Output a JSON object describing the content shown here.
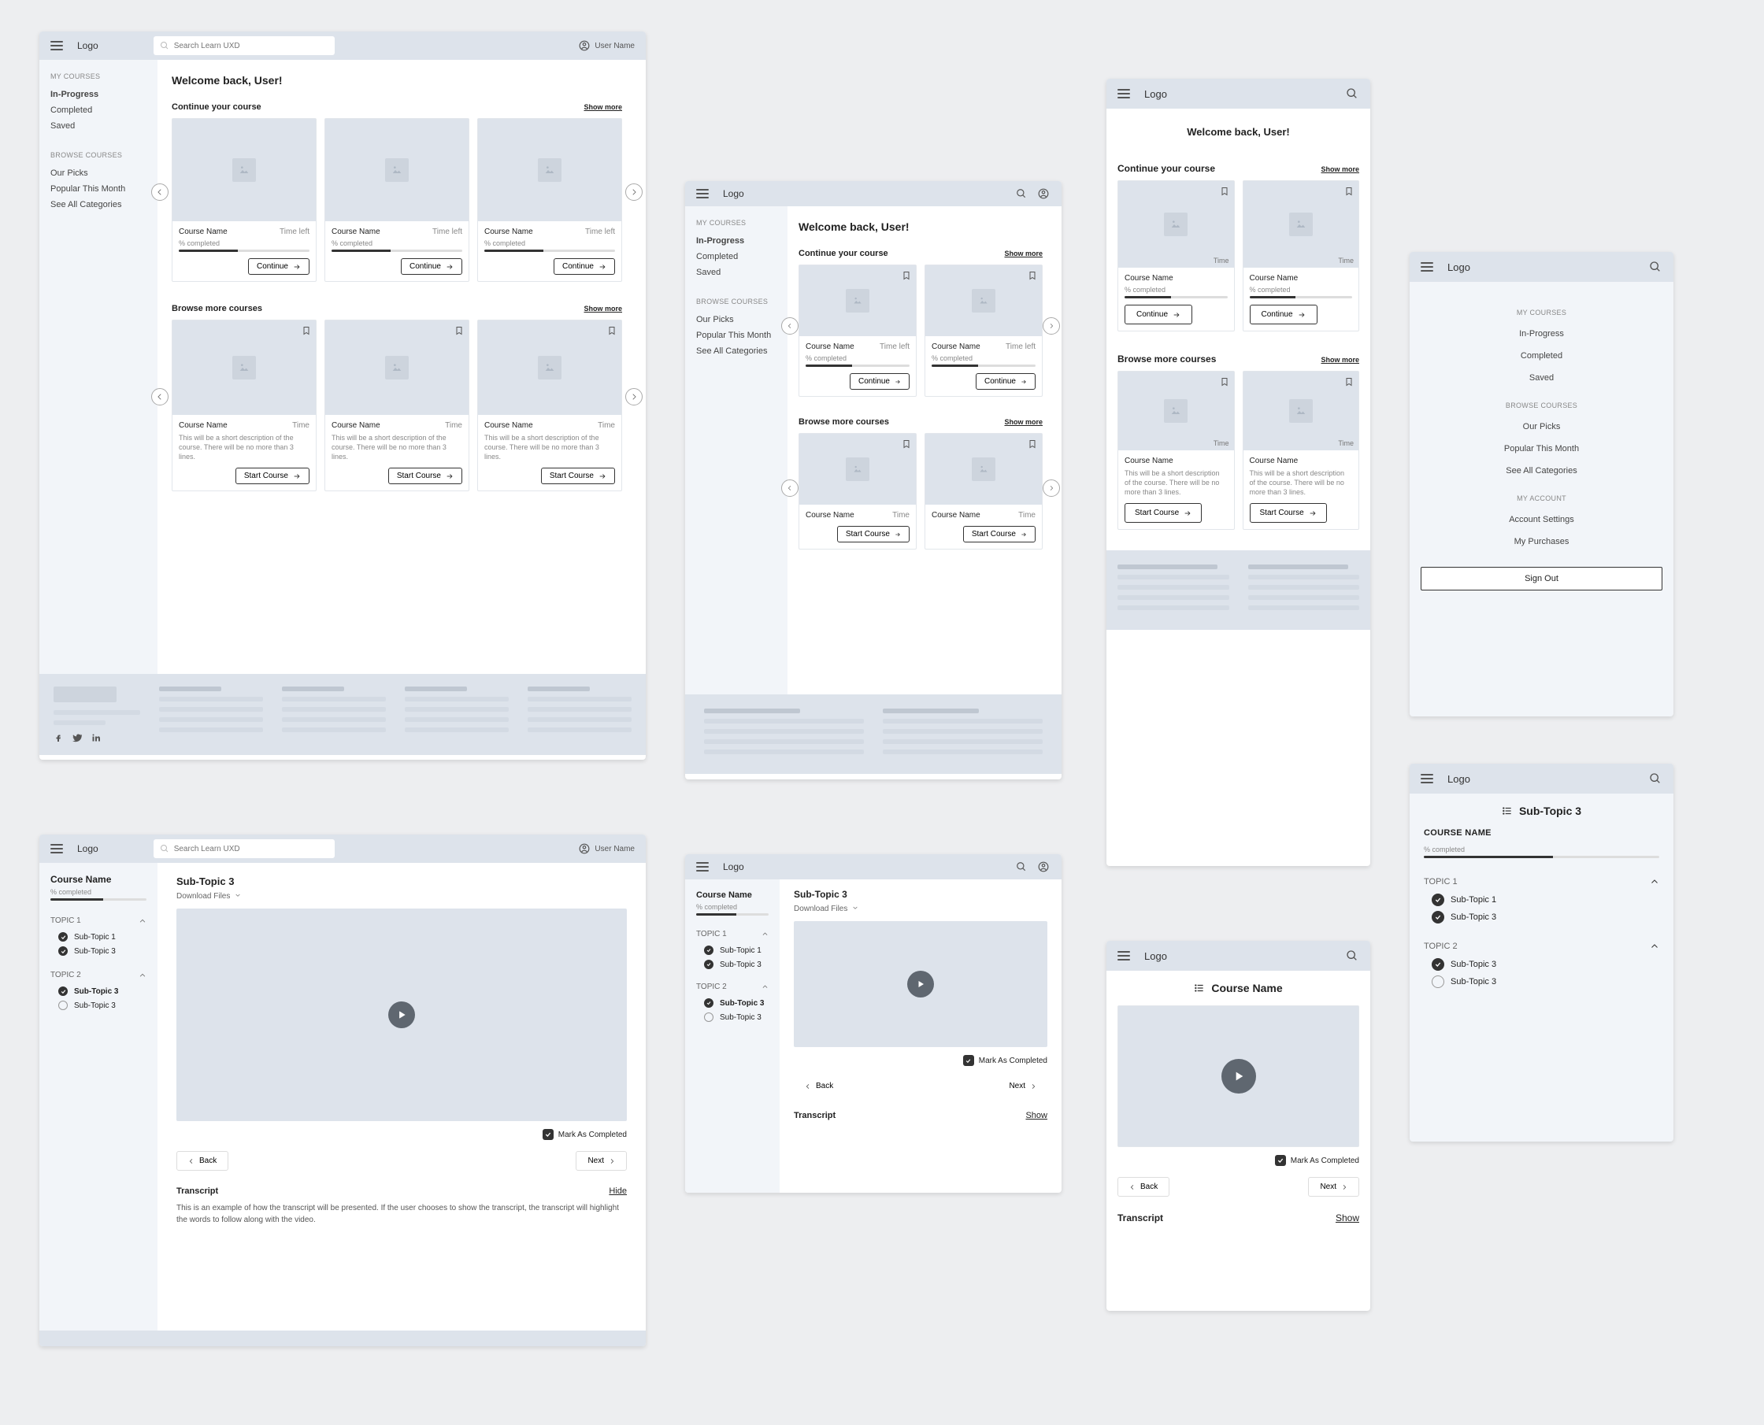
{
  "logo": "Logo",
  "user_name": "User Name",
  "search_placeholder": "Search Learn UXD",
  "welcome": "Welcome back, User!",
  "continue_title": "Continue your course",
  "browse_title": "Browse more courses",
  "show_more": "Show more",
  "sidebar": {
    "my_courses": "MY COURSES",
    "in_progress": "In-Progress",
    "completed": "Completed",
    "saved": "Saved",
    "browse": "BROWSE COURSES",
    "our_picks": "Our Picks",
    "popular": "Popular This Month",
    "all_cats": "See All Categories"
  },
  "card": {
    "name": "Course Name",
    "time_left": "Time left",
    "time": "Time",
    "pc": "% completed",
    "continue": "Continue",
    "start": "Start Course",
    "desc": "This will be a short description of the course. There will be no more than 3 lines."
  },
  "menu": {
    "my_account": "MY ACCOUNT",
    "settings": "Account Settings",
    "purchases": "My Purchases",
    "signout": "Sign Out"
  },
  "course": {
    "name": "Course Name",
    "name_caps": "COURSE NAME",
    "pc": "% completed",
    "topic1": "TOPIC 1",
    "topic2": "TOPIC 2",
    "sub1": "Sub-Topic 1",
    "sub3": "Sub-Topic 3",
    "sub_title": "Sub-Topic 3",
    "download": "Download Files",
    "mark": "Mark As Completed",
    "back": "Back",
    "next": "Next",
    "transcript": "Transcript",
    "hide": "Hide",
    "show": "Show",
    "trans_body": "This is an example of how the transcript will be presented. If the user chooses to show the transcript, the transcript will highlight the words to follow along with the video."
  }
}
